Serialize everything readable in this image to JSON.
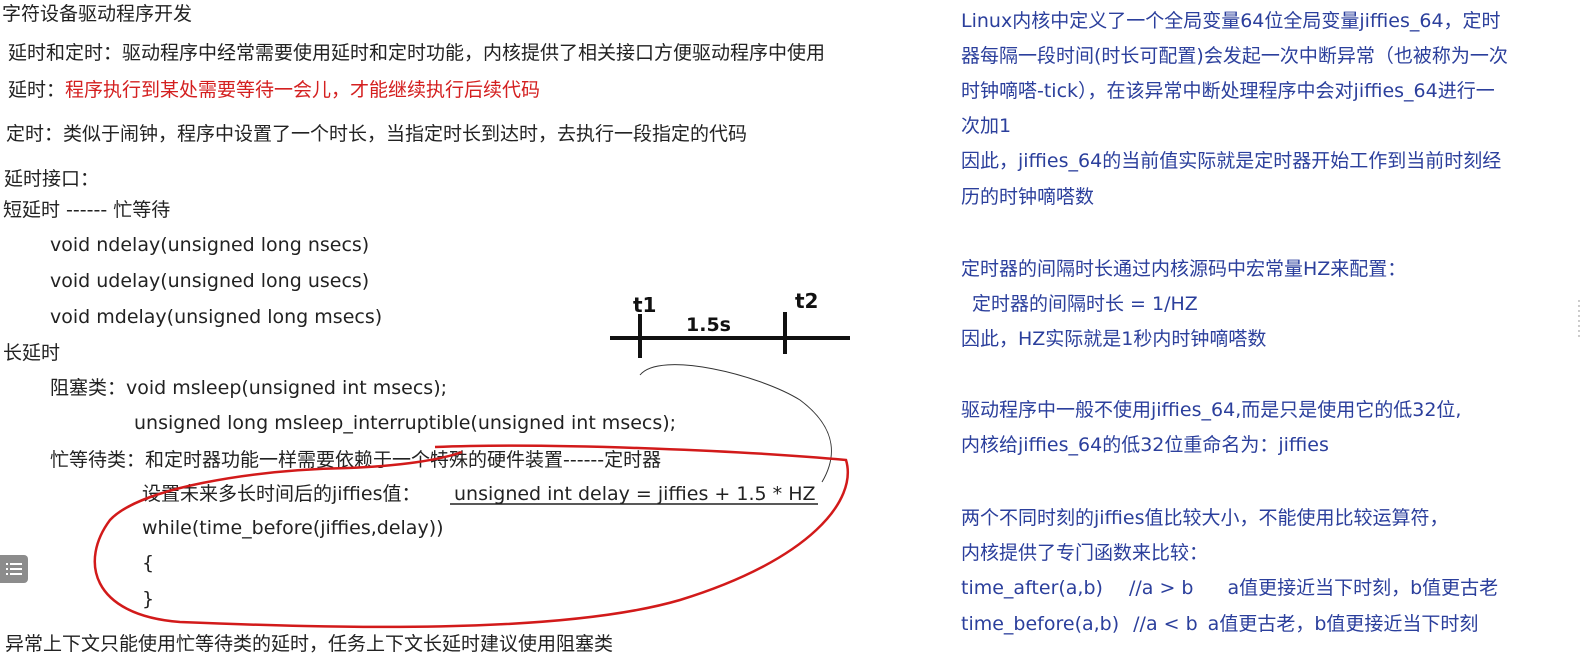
{
  "left": {
    "title": "字符设备驱动程序开发",
    "intro": "延时和定时：驱动程序中经常需要使用延时和定时功能，内核提供了相关接口方便驱动程序中使用",
    "delay_label": "延时：",
    "delay_desc": "程序执行到某处需要等待一会儿，才能继续执行后续代码",
    "timer_def": "定时：类似于闹钟，程序中设置了一个时长，当指定时长到达时，去执行一段指定的代码",
    "delay_api": "延时接口：",
    "short_delay": "短延时 ------ 忙等待",
    "ndelay": "void ndelay(unsigned long nsecs)",
    "udelay": "void udelay(unsigned long usecs)",
    "mdelay": "void mdelay(unsigned long msecs)",
    "long_delay": "长延时",
    "block_line": "阻塞类：void msleep(unsigned int msecs);",
    "msleep_int": "unsigned long msleep_interruptible(unsigned int msecs);",
    "busy_line": "忙等待类：和定时器功能一样需要依赖于一个特殊的硬件装置------定时器",
    "set_future": "设置未来多长时间后的jiffies值：",
    "delay_expr": "unsigned int delay = jiffies + 1.5 * HZ",
    "while_line": "while(time_before(jiffies,delay))",
    "brace_open": "{",
    "brace_close": "}",
    "bottom_note": "异常上下文只能使用忙等待类的延时，任务上下文长延时建议使用阻塞类"
  },
  "diagram": {
    "t1": "t1",
    "t2": "t2",
    "span": "1.5s"
  },
  "right": {
    "p1_l1": "Linux内核中定义了一个全局变量64位全局变量jiffies_64，定时",
    "p1_l2": "器每隔一段时间(时长可配置)会发起一次中断异常（也被称为一次",
    "p1_l3": "时钟嘀嗒-tick），在该异常中断处理程序中会对jiffies_64进行一",
    "p1_l4": "次加1",
    "p2_l1": "因此，jiffies_64的当前值实际就是定时器开始工作到当前时刻经",
    "p2_l2": "历的时钟嘀嗒数",
    "p3_l1": "定时器的间隔时长通过内核源码中宏常量HZ来配置：",
    "p3_l2": "定时器的间隔时长 = 1/HZ",
    "p3_l3": "因此，HZ实际就是1秒内时钟嘀嗒数",
    "p4_l1": "驱动程序中一般不使用jiffies_64,而是只是使用它的低32位,",
    "p4_l2": "内核给jiffies_64的低32位重命名为：jiffies",
    "p5_l1": "两个不同时刻的jiffies值比较大小，不能使用比较运算符，",
    "p5_l2": "内核提供了专门函数来比较：",
    "after_fn": "time_after(a,b)",
    "after_cmt": "//a > b",
    "after_desc": "a值更接近当下时刻，b值更古老",
    "before_fn": "time_before(a,b)",
    "before_cmt": "//a < b",
    "before_desc": "a值更古老，b值更接近当下时刻"
  },
  "colors": {
    "red_text": "#d42020",
    "blue_text": "#2b3f9c",
    "annotation_red": "#d21a1a"
  },
  "icons": {
    "menu": "list-icon"
  }
}
